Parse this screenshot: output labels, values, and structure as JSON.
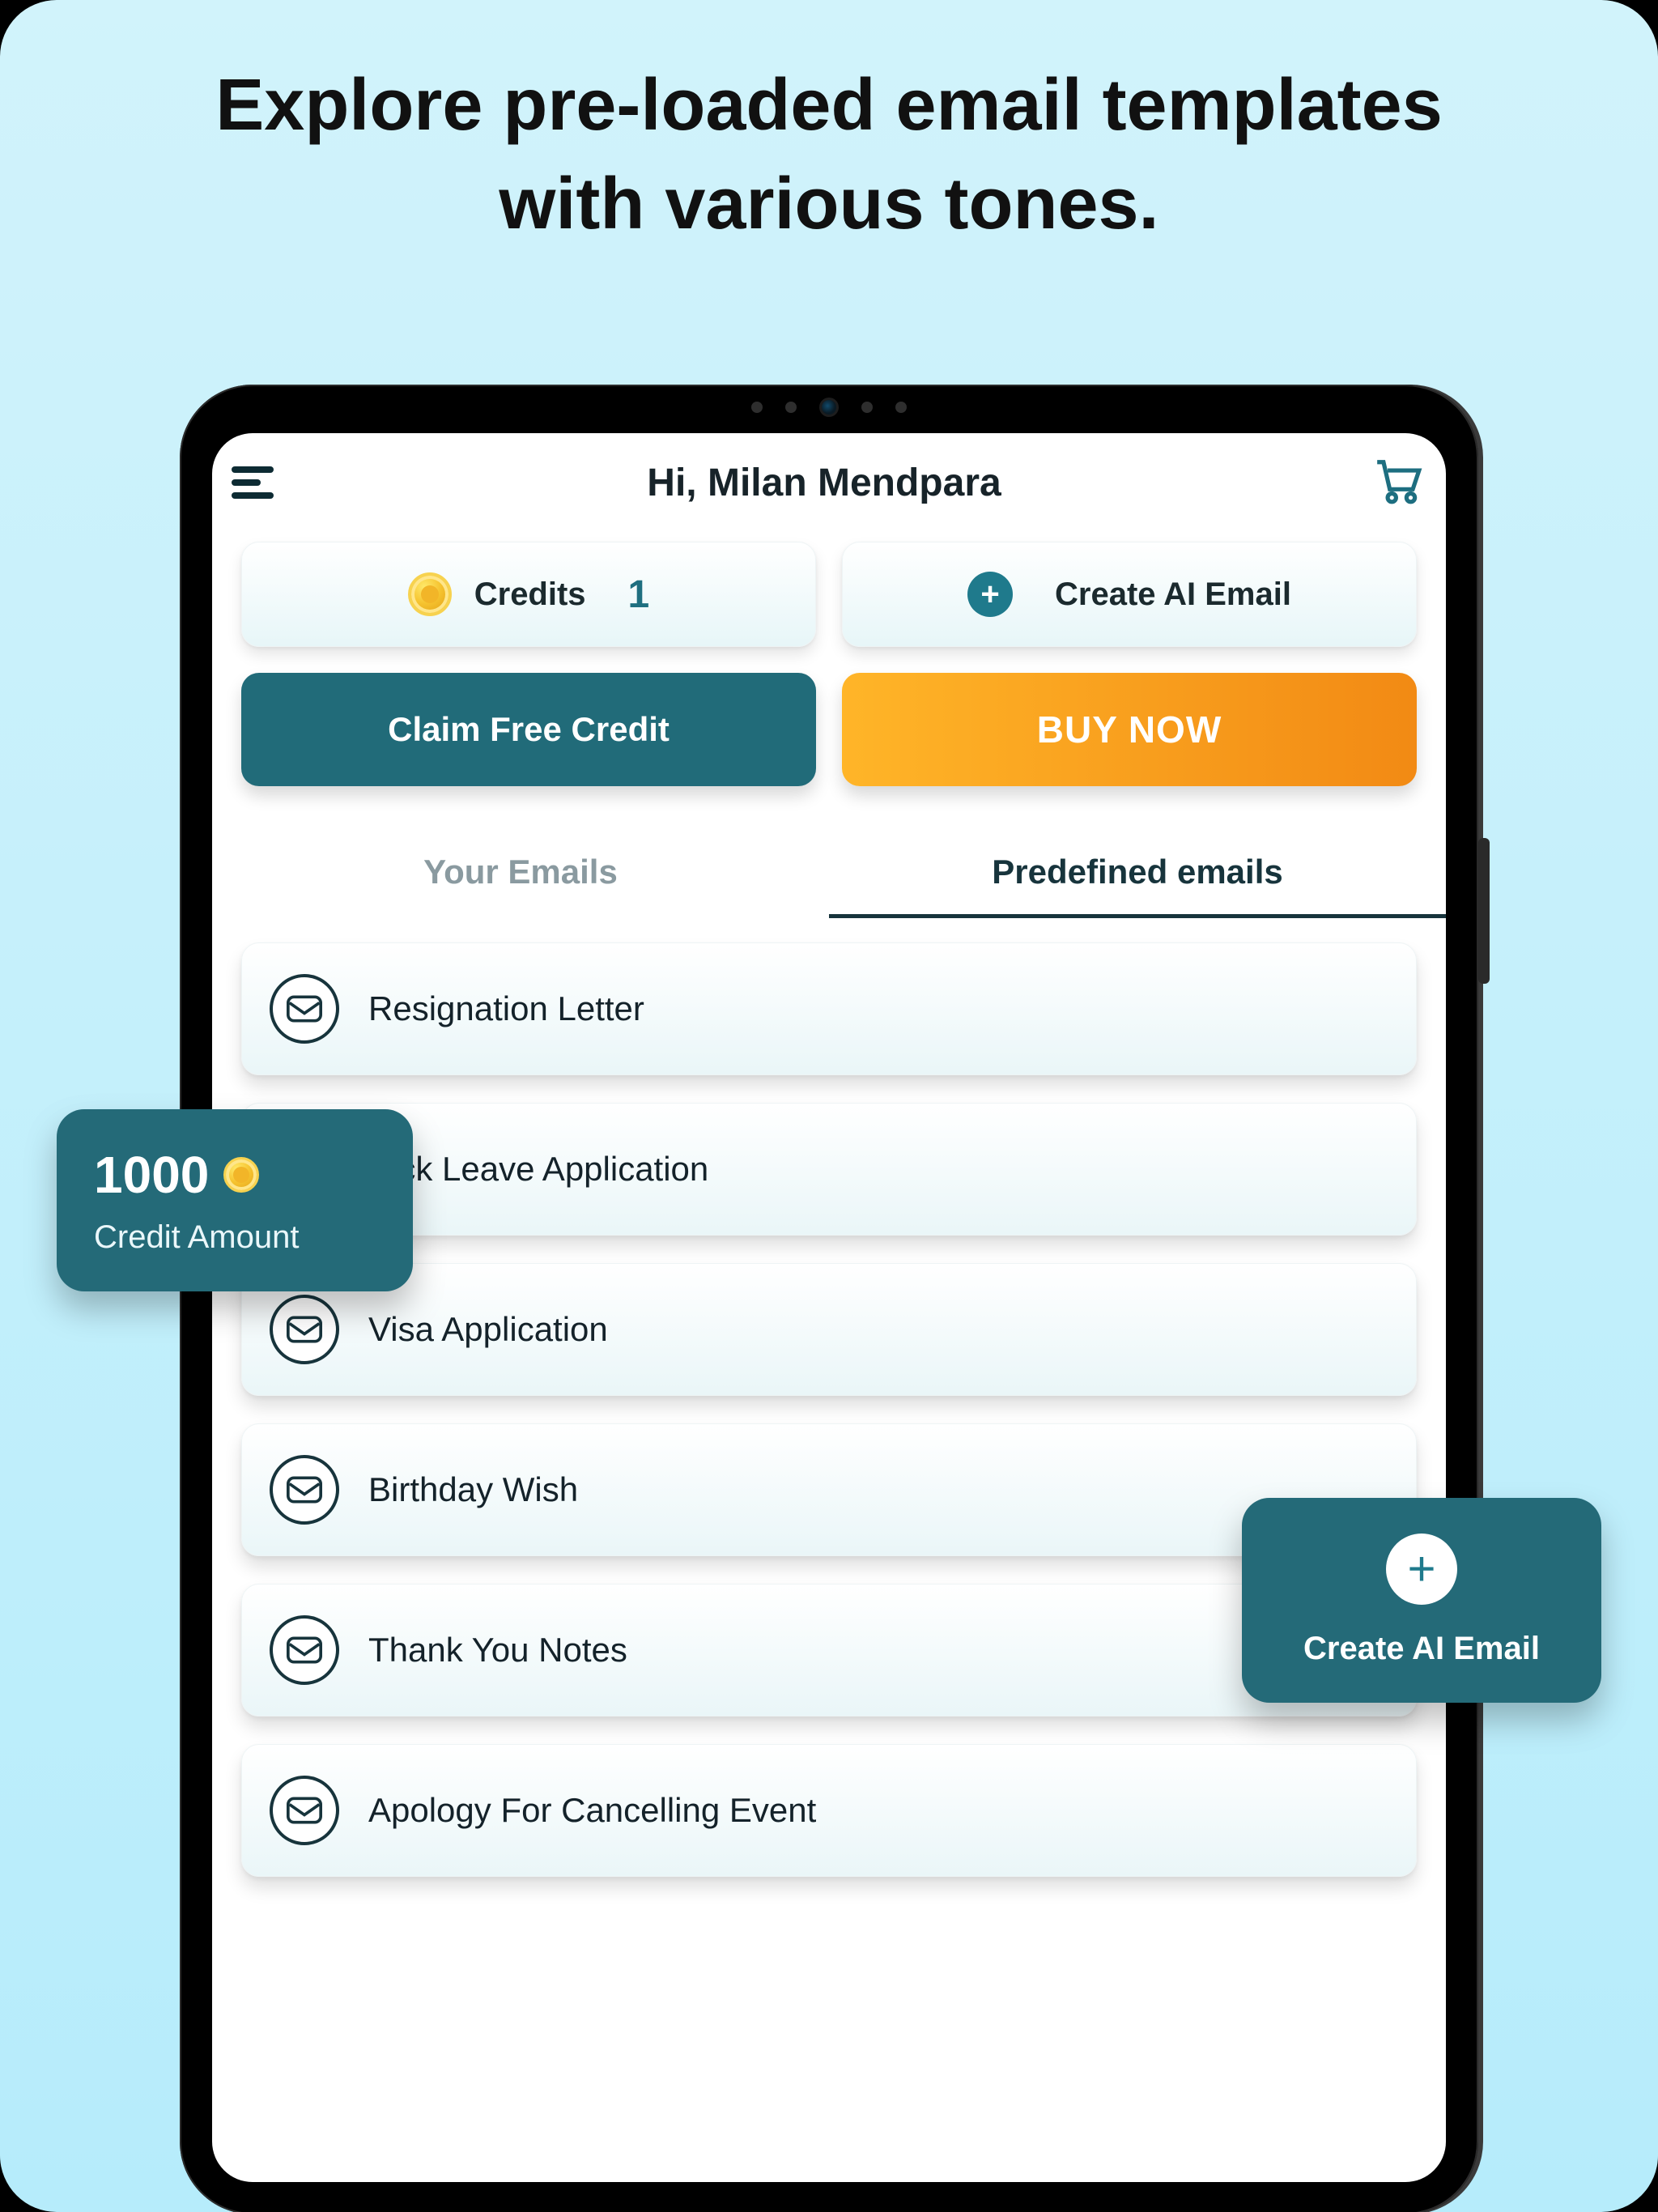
{
  "promo": {
    "headline": "Explore pre-loaded email templates with various tones."
  },
  "header": {
    "greeting": "Hi, Milan Mendpara"
  },
  "cards": {
    "credits_label": "Credits",
    "credits_value": "1",
    "create_label": "Create AI Email"
  },
  "buttons": {
    "claim": "Claim Free Credit",
    "buy": "BUY NOW"
  },
  "tabs": {
    "mine": "Your Emails",
    "predefined": "Predefined emails"
  },
  "templates": [
    {
      "title": "Resignation Letter"
    },
    {
      "title": "Sick Leave Application"
    },
    {
      "title": "Visa Application"
    },
    {
      "title": "Birthday Wish"
    },
    {
      "title": "Thank You Notes"
    },
    {
      "title": "Apology For Cancelling Event"
    }
  ],
  "callouts": {
    "credit_amount_value": "1000",
    "credit_amount_label": "Credit Amount",
    "create_ai": "Create AI Email"
  },
  "colors": {
    "teal": "#216b79",
    "orange_start": "#ffb528",
    "orange_end": "#f28a14",
    "text_dark": "#17343c"
  }
}
